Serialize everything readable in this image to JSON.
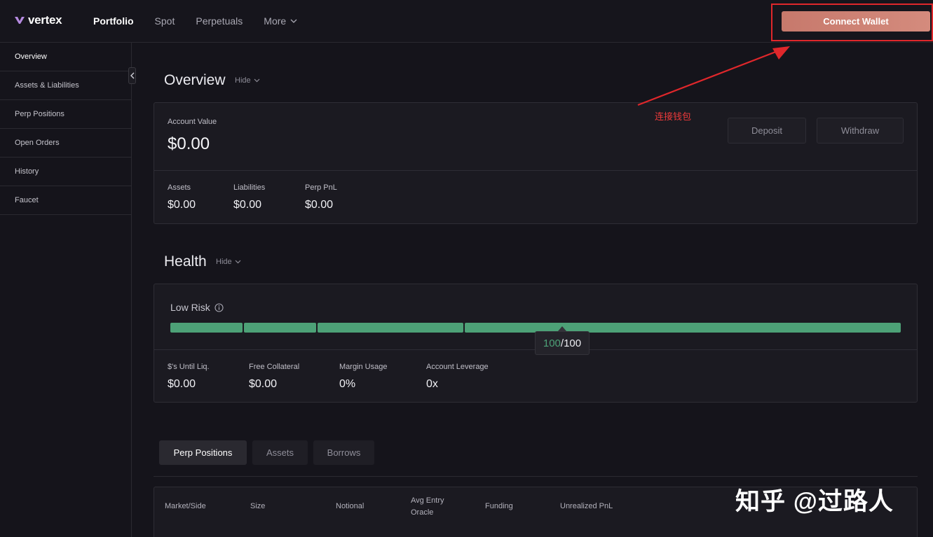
{
  "header": {
    "logo_text": "vertex",
    "nav": [
      {
        "label": "Portfolio",
        "active": true
      },
      {
        "label": "Spot",
        "active": false
      },
      {
        "label": "Perpetuals",
        "active": false
      },
      {
        "label": "More",
        "active": false
      }
    ],
    "connect_wallet_label": "Connect Wallet"
  },
  "sidebar": {
    "items": [
      {
        "label": "Overview",
        "active": true
      },
      {
        "label": "Assets & Liabilities",
        "active": false
      },
      {
        "label": "Perp Positions",
        "active": false
      },
      {
        "label": "Open Orders",
        "active": false
      },
      {
        "label": "History",
        "active": false
      },
      {
        "label": "Faucet",
        "active": false
      }
    ]
  },
  "overview": {
    "title": "Overview",
    "hide_label": "Hide",
    "account_value_label": "Account Value",
    "account_value": "$0.00",
    "deposit_label": "Deposit",
    "withdraw_label": "Withdraw",
    "stats": [
      {
        "label": "Assets",
        "value": "$0.00"
      },
      {
        "label": "Liabilities",
        "value": "$0.00"
      },
      {
        "label": "Perp PnL",
        "value": "$0.00"
      }
    ]
  },
  "annotation": {
    "text": "连接钱包",
    "color": "#ee3a3a"
  },
  "health": {
    "title": "Health",
    "hide_label": "Hide",
    "risk_label": "Low Risk",
    "score": 100,
    "score_text": "100",
    "max_text": "/100",
    "bar_color": "#4da177",
    "stats": [
      {
        "label": "$'s Until Liq.",
        "value": "$0.00"
      },
      {
        "label": "Free Collateral",
        "value": "$0.00"
      },
      {
        "label": "Margin Usage",
        "value": "0%"
      },
      {
        "label": "Account Leverage",
        "value": "0x"
      }
    ]
  },
  "tabs": [
    {
      "label": "Perp Positions",
      "active": true
    },
    {
      "label": "Assets",
      "active": false
    },
    {
      "label": "Borrows",
      "active": false
    }
  ],
  "table": {
    "columns": [
      "Market/Side",
      "Size",
      "Notional",
      "Avg Entry",
      "Oracle",
      "Funding",
      "Unrealized PnL"
    ]
  },
  "watermark": "知乎 @过路人",
  "colors": {
    "accent": "#c7796c",
    "health_green": "#4da177",
    "highlight_red": "#e0272b"
  }
}
